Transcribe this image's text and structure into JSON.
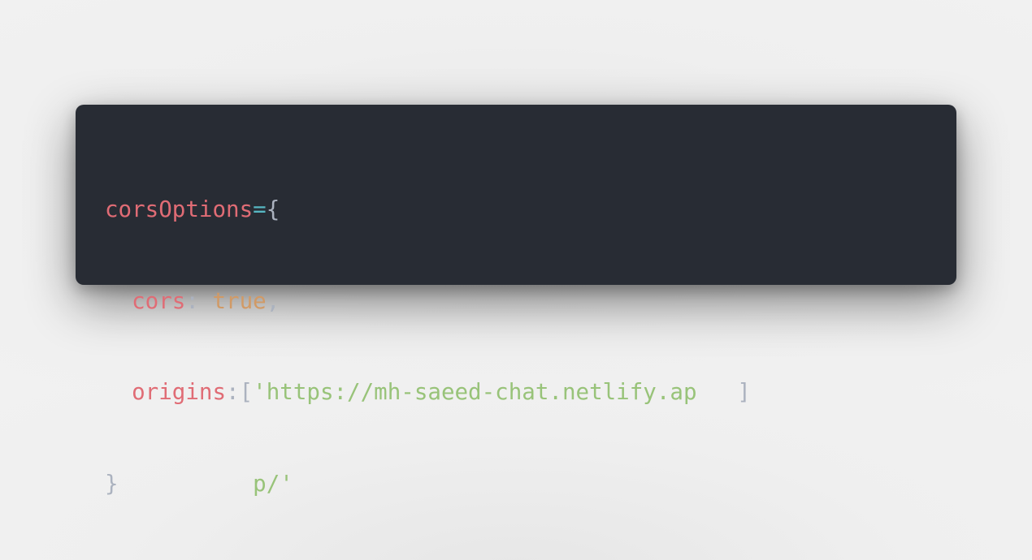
{
  "code": {
    "line1": {
      "var": "corsOptions",
      "op": "=",
      "brace_open": "{"
    },
    "line2": {
      "indent": "  ",
      "prop": "cors",
      "colon": ": ",
      "value": "true",
      "comma": ","
    },
    "line3": {
      "indent": "  ",
      "prop": "origins",
      "colon": ":",
      "bracket_open": "[",
      "string_part1": "'https://mh-saeed-chat.netlify.ap",
      "gap": "   ",
      "bracket_close": "]"
    },
    "line4": {
      "brace_close": "}",
      "gap": "          ",
      "string_part2": "p/'"
    }
  },
  "colors": {
    "background": "#282c34",
    "variable": "#e06c75",
    "operator": "#56b6c2",
    "punctuation": "#abb2bf",
    "boolean": "#d19a66",
    "string": "#98c379"
  }
}
